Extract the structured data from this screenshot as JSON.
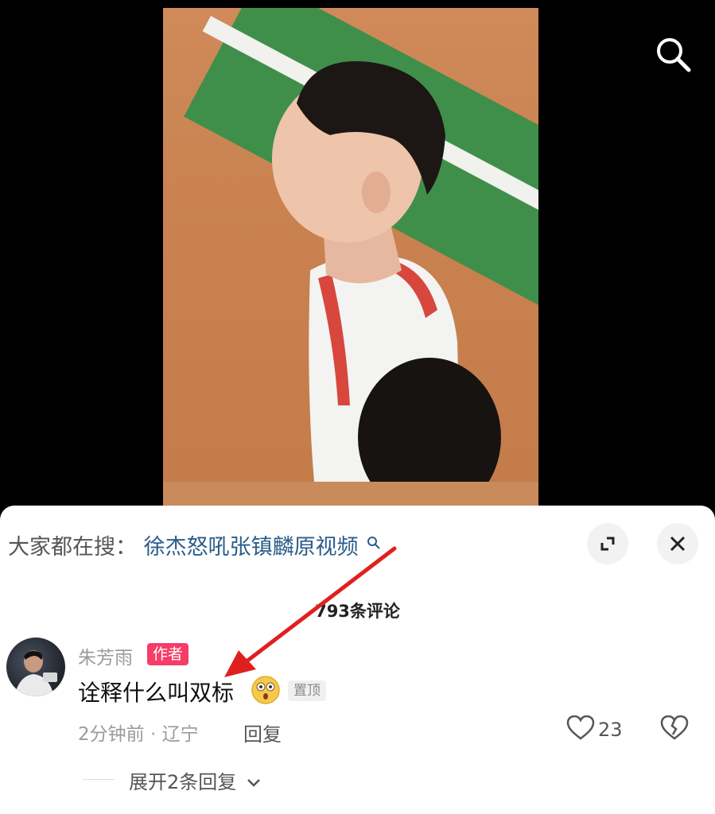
{
  "video": {
    "search_icon": "search-icon"
  },
  "panel": {
    "suggest_prefix": "大家都在搜：",
    "suggest_link": "徐杰怒吼张镇麟原视频",
    "comment_count": "793条评论"
  },
  "comment": {
    "author": "朱芳雨",
    "author_badge": "作者",
    "text": "诠释什么叫双标",
    "emoji": "face-emoji",
    "pin_badge": "置顶",
    "time": "2分钟前",
    "location": "辽宁",
    "meta_sep": "·",
    "reply_label": "回复",
    "like_count": "23",
    "expand_replies": "展开2条回复"
  },
  "colors": {
    "author_badge_bg": "#f53d67",
    "link": "#2b5c8a",
    "annotation_arrow": "#e02020"
  }
}
